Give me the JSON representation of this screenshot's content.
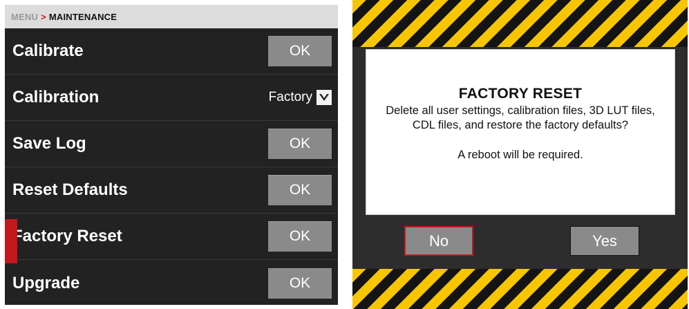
{
  "menu": {
    "breadcrumb": {
      "root": "MENU",
      "separator": ">",
      "current": "MAINTENANCE"
    },
    "items": [
      {
        "label": "Calibrate",
        "control": "button",
        "button_label": "OK"
      },
      {
        "label": "Calibration",
        "control": "dropdown",
        "value": "Factory"
      },
      {
        "label": "Save Log",
        "control": "button",
        "button_label": "OK"
      },
      {
        "label": "Reset Defaults",
        "control": "button",
        "button_label": "OK"
      },
      {
        "label": "Factory Reset",
        "control": "button",
        "button_label": "OK",
        "selected": true
      },
      {
        "label": "Upgrade",
        "control": "button",
        "button_label": "OK"
      }
    ]
  },
  "dialog": {
    "title": "FACTORY RESET",
    "message": "Delete all user settings, calibration files, 3D LUT files, CDL files, and restore the factory defaults?",
    "note": "A reboot will be required.",
    "no_label": "No",
    "yes_label": "Yes"
  },
  "colors": {
    "accent_red": "#c4181c",
    "hazard_yellow": "#f7c600",
    "hazard_black": "#141414",
    "menu_background": "#222222",
    "button_gray": "#8a8a8a"
  },
  "icons": {
    "dropdown": "chevron-down-icon"
  }
}
